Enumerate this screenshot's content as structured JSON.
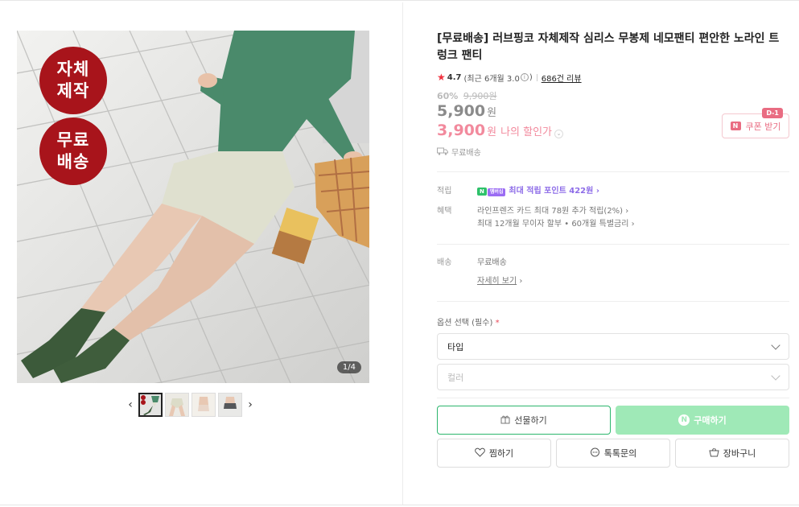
{
  "gallery": {
    "badges": [
      {
        "line1": "자체",
        "line2": "제작"
      },
      {
        "line1": "무료",
        "line2": "배송"
      }
    ],
    "counter": "1/4",
    "prev_label": "‹",
    "next_label": "›"
  },
  "product": {
    "title": "[무료배송] 러브핑코 자체제작 심리스 무봉제 네모팬티 편안한 노라인 트렁크 팬티",
    "rating": {
      "star": "★",
      "score": "4.7",
      "recent_prefix": "(최근 6개월 3.0",
      "info": "i",
      "recent_suffix": ")",
      "reviews": "686건 리뷰"
    },
    "price": {
      "discount_pct": "60%",
      "original": "9,900원",
      "current": "5,900",
      "won": "원",
      "my_price": "3,900",
      "my_won": "원",
      "my_label": "나의 할인가",
      "chevron": "⌄"
    },
    "coupon": {
      "dday": "D-1",
      "n": "N",
      "label": "쿠폰 받기"
    },
    "shipping_short": "무료배송"
  },
  "benefits": {
    "points_label": "적립",
    "npay": "N",
    "npay_plus": "멤버십",
    "points_text": "최대 적립 포인트 422원 ›",
    "perks_label": "혜택",
    "perk1": "라인프렌즈 카드 최대 78원 추가 적립(2%) ›",
    "perk2": "최대 12개월 무이자 할부 • 60개월 특별금리 ›"
  },
  "delivery": {
    "label": "배송",
    "value": "무료배송",
    "detail_link": "자세히 보기",
    "detail_arrow": "›"
  },
  "options": {
    "label": "옵션 선택 (필수)",
    "required_mark": "*",
    "type_placeholder": "타입",
    "color_placeholder": "컬러"
  },
  "actions": {
    "gift": "선물하기",
    "buy": "구매하기",
    "buy_n": "N",
    "wish": "찜하기",
    "talk": "톡톡문의",
    "cart": "장바구니"
  },
  "colors": {
    "badge_red": "#a8141b",
    "price_pink": "#f28a9d",
    "buy_green": "#9fe9b7",
    "gift_border": "#2cb66d",
    "points_purple": "#8d6ce8"
  }
}
